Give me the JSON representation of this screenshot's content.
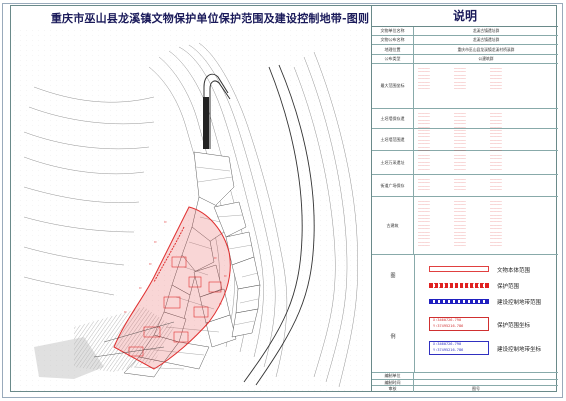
{
  "title": "重庆市巫山县龙溪镇文物保护单位保护范围及建设控制地带-图则",
  "panel": {
    "heading": "说明",
    "rows": [
      {
        "label": "文物单位名称",
        "value": "龙溪古镇遗址群"
      },
      {
        "label": "文物公布名称",
        "value": "龙溪古镇遗址群"
      },
      {
        "label": "地理位置",
        "value": "重庆市巫山县龙溪镇龙溪村桥溪群"
      },
      {
        "label": "公布类型",
        "value": "公建筑群"
      }
    ],
    "coord_sections": [
      {
        "label": "最大范围坐标",
        "lines": 7
      },
      {
        "label": "土坯墙保存遗",
        "lines": 6
      },
      {
        "label": "土坯墙范围遗",
        "lines": 6
      },
      {
        "label": "土坯万采遗址",
        "lines": 5
      },
      {
        "label": "街道广场保存",
        "lines": 4
      },
      {
        "label": "古建筑",
        "lines": 14
      }
    ],
    "legend_heading": "图",
    "example_heading": "例",
    "legend": [
      {
        "label": "文物本体范围",
        "color": "#e04040"
      },
      {
        "label": "保护范围",
        "color": "#e02020"
      },
      {
        "label": "建设控制地带范围",
        "color": "#2020c0"
      },
      {
        "label": "保护范围坐标",
        "color": "#d03030"
      },
      {
        "label": "建设控制地带坐标",
        "color": "#3030c0"
      }
    ],
    "coord_tag_1": [
      "X:3460726.790",
      "Y:37495216.786"
    ],
    "coord_tag_2": [
      "X:3460726.790",
      "Y:37495216.786"
    ],
    "footer": [
      {
        "label": "编制单位",
        "value": ""
      },
      {
        "label": "编制时间",
        "value": ""
      },
      {
        "label": "审核",
        "value": "图号"
      }
    ]
  },
  "colors": {
    "protection": "#e03030",
    "control": "#2a2ab8",
    "contour": "#555555",
    "road": "#444444"
  }
}
